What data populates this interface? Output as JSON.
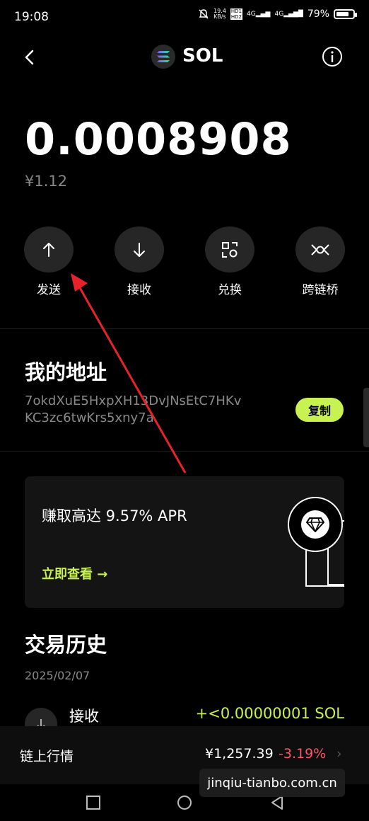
{
  "status_bar": {
    "time": "19:08",
    "net_speed_top": "19.4",
    "net_speed_bottom": "KB/s",
    "hd1": "HD1",
    "hd2": "HD2",
    "sig1": "4G",
    "sig2": "4G",
    "battery": "79%",
    "battery_level": 0.79
  },
  "header": {
    "coin_name": "SOL"
  },
  "balance": {
    "amount": "0.0008908",
    "fiat": "¥1.12"
  },
  "actions": [
    {
      "label": "发送",
      "icon": "arrow-up-icon"
    },
    {
      "label": "接收",
      "icon": "arrow-down-icon"
    },
    {
      "label": "兑换",
      "icon": "swap-icon"
    },
    {
      "label": "跨链桥",
      "icon": "bridge-icon"
    }
  ],
  "address": {
    "title": "我的地址",
    "line1": "7okdXuE5HxpXH13DvJNsEtC7HKv",
    "line2": "KC3zc6twKrs5xny7a",
    "copy_label": "复制"
  },
  "promo": {
    "title": "赚取高达 9.57% APR",
    "link": "立即查看 →"
  },
  "history": {
    "title": "交易历史",
    "date": "2025/02/07",
    "tx_label": "接收",
    "tx_amount": "+<0.00000001 SOL"
  },
  "market": {
    "label": "链上行情",
    "price": "¥1,257.39",
    "change": "-3.19%",
    "chevron": "›"
  },
  "watermark": "jinqiu-tianbo.com.cn",
  "colors": {
    "accent": "#c8f251",
    "negative": "#ff5468",
    "background": "#000000"
  }
}
